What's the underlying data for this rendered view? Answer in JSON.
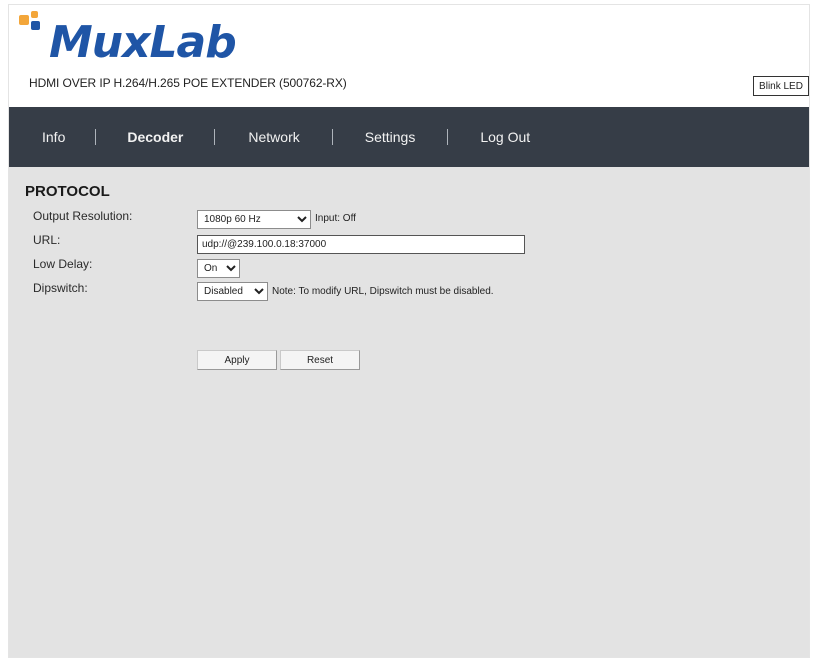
{
  "header": {
    "logo_text": "MuxLab",
    "device_title": "HDMI OVER IP H.264/H.265 POE EXTENDER (500762-RX)",
    "blink_led_label": "Blink LED"
  },
  "nav": {
    "items": [
      {
        "label": "Info",
        "active": false
      },
      {
        "label": "Decoder",
        "active": true
      },
      {
        "label": "Network",
        "active": false
      },
      {
        "label": "Settings",
        "active": false
      },
      {
        "label": "Log Out",
        "active": false
      }
    ]
  },
  "protocol": {
    "title": "PROTOCOL",
    "output_resolution": {
      "label": "Output Resolution:",
      "value": "1080p 60 Hz",
      "note": "Input: Off"
    },
    "url": {
      "label": "URL:",
      "value": "udp://@239.100.0.18:37000"
    },
    "low_delay": {
      "label": "Low Delay:",
      "value": "On"
    },
    "dipswitch": {
      "label": "Dipswitch:",
      "value": "Disabled",
      "note": "Note: To modify URL, Dipswitch must be disabled."
    },
    "apply_label": "Apply",
    "reset_label": "Reset"
  },
  "colors": {
    "navbar": "#363d47",
    "content_bg": "#e3e3e3",
    "logo_blue": "#1f55a6",
    "logo_orange": "#f3a63a"
  }
}
